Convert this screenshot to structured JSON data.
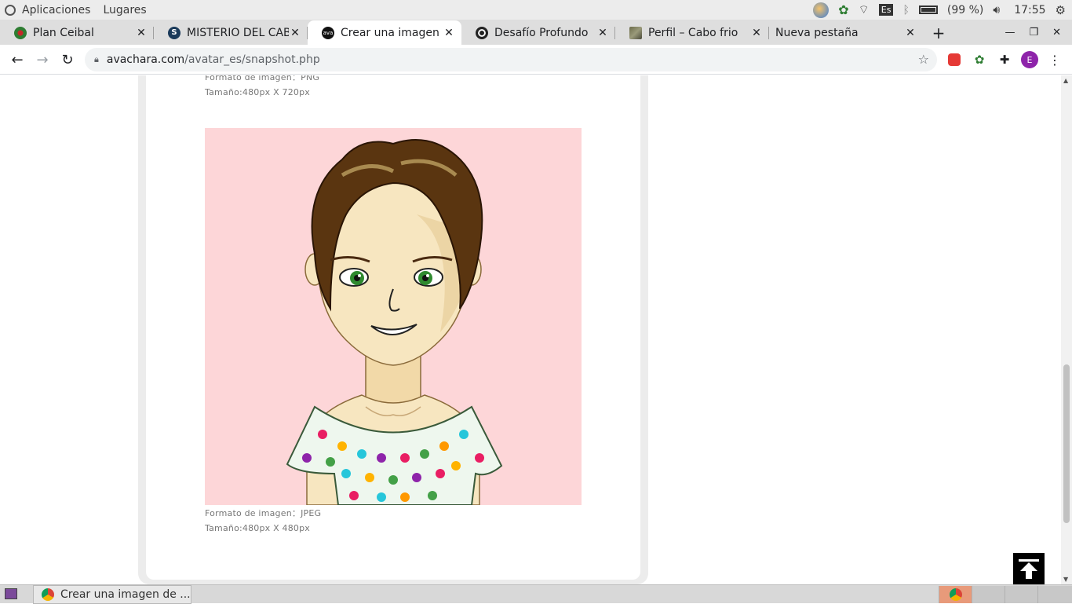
{
  "system_bar": {
    "apps_label": "Aplicaciones",
    "places_label": "Lugares",
    "keyboard_layout": "Es",
    "battery_text": "(99 %)",
    "clock": "17:55"
  },
  "tabs": [
    {
      "title": "Plan Ceibal",
      "favicon": "ceibal-icon",
      "active": false
    },
    {
      "title": "MISTERIO DEL CAB",
      "favicon": "s-icon",
      "active": false
    },
    {
      "title": "Crear una imagen d",
      "favicon": "avachara-icon",
      "active": true
    },
    {
      "title": "Desafío Profundo",
      "favicon": "globe-icon",
      "active": false
    },
    {
      "title": "Perfil – Cabo frio",
      "favicon": "photo-icon",
      "active": false
    },
    {
      "title": "Nueva pestaña",
      "favicon": "",
      "active": false
    }
  ],
  "address_bar": {
    "host": "avachara.com",
    "path": "/avatar_es/snapshot.php"
  },
  "profile_initial": "E",
  "content": {
    "png_format_label": "Formato de imagen：PNG",
    "png_size_label": "Tamaño:480px X 720px",
    "jpeg_format_label": "Formato de imagen：JPEG",
    "jpeg_size_label": "Tamaño:480px X 480px"
  },
  "taskbar": {
    "window_title": "Crear una imagen de ..."
  },
  "colors": {
    "avatar_background": "#fdd6d8",
    "hair": "#5a3510",
    "skin": "#f7e6c0",
    "eyes": "#2f8a2f",
    "profile_avatar": "#8e24aa"
  }
}
